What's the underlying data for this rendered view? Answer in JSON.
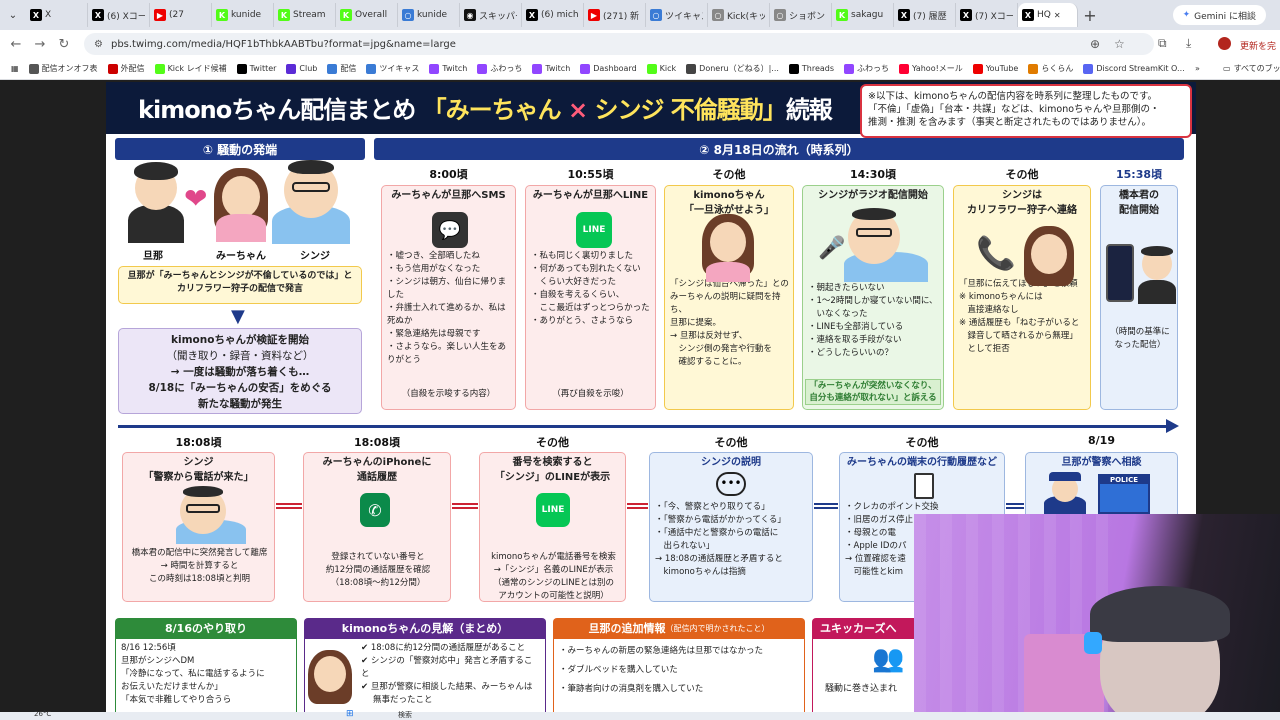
{
  "tabs": [
    {
      "label": "X",
      "color": "#000",
      "glyph": "X"
    },
    {
      "label": "(6) Xコー",
      "color": "#000",
      "glyph": "X"
    },
    {
      "label": "(27",
      "color": "#e00",
      "glyph": "▶"
    },
    {
      "label": "kunide",
      "color": "#53fc18",
      "glyph": "K"
    },
    {
      "label": "Stream",
      "color": "#53fc18",
      "glyph": "K"
    },
    {
      "label": "Overall",
      "color": "#53fc18",
      "glyph": "K"
    },
    {
      "label": "kunide",
      "color": "#3a7bd5",
      "glyph": "○"
    },
    {
      "label": "スキッパー",
      "color": "#111",
      "glyph": "◉"
    },
    {
      "label": "(6) mich",
      "color": "#000",
      "glyph": "X"
    },
    {
      "label": "(271) 新",
      "color": "#e00",
      "glyph": "▶"
    },
    {
      "label": "ツイキャス",
      "color": "#3a7bd5",
      "glyph": "○"
    },
    {
      "label": "Kick(キッ",
      "color": "#888",
      "glyph": "○"
    },
    {
      "label": "ショボン",
      "color": "#888",
      "glyph": "○"
    },
    {
      "label": "sakagu",
      "color": "#53fc18",
      "glyph": "K"
    },
    {
      "label": "(7) 履歴",
      "color": "#000",
      "glyph": "X"
    },
    {
      "label": "(7) Xコー",
      "color": "#000",
      "glyph": "X"
    },
    {
      "label": "HQ",
      "color": "#000",
      "glyph": "X",
      "active": true
    }
  ],
  "gemini_label": "Gemini に相談",
  "url": "pbs.twimg.com/media/HQF1bThbkAABTbu?format=jpg&name=large",
  "update_label": "更新を完",
  "bookmarks": [
    {
      "label": "配信オンオフ表",
      "color": "#555"
    },
    {
      "label": "外配信",
      "color": "#c00"
    },
    {
      "label": "Kick レイド候補",
      "color": "#53fc18"
    },
    {
      "label": "Twitter",
      "color": "#000"
    },
    {
      "label": "Club",
      "color": "#5b2bd6"
    },
    {
      "label": "配信",
      "color": "#3a7bd5"
    },
    {
      "label": "ツイキャス",
      "color": "#3a7bd5"
    },
    {
      "label": "Twitch",
      "color": "#9146ff"
    },
    {
      "label": "ふわっち",
      "color": "#9146ff"
    },
    {
      "label": "Twitch",
      "color": "#9146ff"
    },
    {
      "label": "Dashboard",
      "color": "#9146ff"
    },
    {
      "label": "Kick",
      "color": "#53fc18"
    },
    {
      "label": "Doneru（どねる）|...",
      "color": "#444"
    },
    {
      "label": "Threads",
      "color": "#000"
    },
    {
      "label": "ふわっち",
      "color": "#9146ff"
    },
    {
      "label": "Yahoo!メール",
      "color": "#f03"
    },
    {
      "label": "YouTube",
      "color": "#e00"
    },
    {
      "label": "らくらん",
      "color": "#e07b00"
    },
    {
      "label": "Discord StreamKit O...",
      "color": "#5865f2"
    }
  ],
  "all_bookmarks": "すべてのブッ",
  "infographic": {
    "title_a": "kimonoちゃん配信まとめ",
    "title_b": "「みーちゃん",
    "title_x": "×",
    "title_c": "シンジ 不倫騒動」",
    "title_d": "続報",
    "notice_1": "※以下は、kimonoちゃんの配信内容を時系列に整理したものです。",
    "notice_2": "「不倫」「虚偽」「台本・共謀」などは、kimonoちゃんや旦那側の・",
    "notice_3": "推測・推測 を含みます（事実と断定されたものではありません）。",
    "sec1": "① 騒動の発端",
    "sec2": "② 8月18日の流れ（時系列）",
    "people": [
      "旦那",
      "みーちゃん",
      "シンジ"
    ],
    "origin_note": "旦那が「みーちゃんとシンジが不倫しているのでは」とカリフラワー狩子の配信で発言",
    "origin_box": [
      "kimonoちゃんが検証を開始",
      "（聞き取り・録音・資料など）",
      "→ 一度は騒動が落ち着くも…",
      "8/18に「みーちゃんの安否」をめぐる",
      "新たな騒動が発生"
    ],
    "top_cols": [
      {
        "time": "8:00頃",
        "head": "みーちゃんが旦那へSMS",
        "lines": [
          "・嘘つき、全部晒したね",
          "・もう信用がなくなった",
          "・シンジは朝方、仙台に帰りました",
          "・弁護士入れて進めるか、私は死ぬか",
          "・緊急連絡先は母親です",
          "・さようなら。楽しい人生をありがとう"
        ],
        "foot": "（自殺を示唆する内容）"
      },
      {
        "time": "10:55頃",
        "head": "みーちゃんが旦那へLINE",
        "lines": [
          "・私も同じく裏切りました",
          "・何があっても別れたくない",
          "　くらい大好きだった",
          "・自殺を考えるくらい、",
          "　ここ最近はずっとつらかった",
          "・ありがとう、さようなら"
        ],
        "foot": "（再び自殺を示唆）"
      },
      {
        "time": "その他",
        "head": "kimonoちゃん",
        "head2": "「一旦泳がせよう」",
        "lines": [
          "「シンジは仙台へ帰った」との",
          "みーちゃんの説明に疑問を持ち、",
          "旦那に提案。",
          "→ 旦那は反対せず、",
          "　シンジ側の発言や行動を",
          "　確認することに。"
        ]
      },
      {
        "time": "14:30頃",
        "head": "シンジがラジオ配信開始",
        "lines": [
          "・朝起きたらいない",
          "・1〜2時間しか寝ていない間に、",
          "　いなくなった",
          "・LINEも全部消している",
          "・連絡を取る手段がない",
          "・どうしたらいいの？"
        ],
        "foot": "「みーちゃんが突然いなくなり、自分も連絡が取れない」と訴える"
      },
      {
        "time": "その他",
        "head": "シンジは",
        "head2": "カリフラワー狩子へ連絡",
        "lines": [
          "「旦那に伝えてほしい」と依頼",
          "※ kimonoちゃんには",
          "　直接連絡なし",
          "※ 通話履歴も「ねむ子がいると",
          "　録音して晒されるから無理」",
          "　として拒否"
        ]
      },
      {
        "time": "15:38頃",
        "head": "橋本君の",
        "head2": "配信開始",
        "lines": [
          "（時間の基準に",
          "なった配信）"
        ]
      }
    ],
    "bottom_cols": [
      {
        "time": "18:08頃",
        "head": "シンジ",
        "head2": "「警察から電話が来た」",
        "lines": [
          "橋本君の配信中に突然発言して離席",
          "→ 時間を計算すると",
          "この時刻は18:08頃と判明"
        ]
      },
      {
        "time": "18:08頃",
        "head": "みーちゃんのiPhoneに",
        "head2": "通話履歴",
        "lines": [
          "登録されていない番号と",
          "約12分間の通話履歴を確認",
          "（18:08頃〜約12分間）"
        ]
      },
      {
        "time": "その他",
        "head": "番号を検索すると",
        "head2": "「シンジ」のLINEが表示",
        "lines": [
          "kimonoちゃんが電話番号を検索",
          "→「シンジ」名義のLINEが表示",
          "（通常のシンジのLINEとは別の",
          "アカウントの可能性と説明）"
        ]
      },
      {
        "time": "その他",
        "head": "シンジの説明",
        "lines": [
          "・「今、警察とやり取りてる」",
          "・「警察から電話がかかってくる」",
          "・「通話中だと警察からの電話に",
          "　出られない」",
          "→ 18:08の通話履歴と矛盾すると",
          "　kimonoちゃんは指摘"
        ]
      },
      {
        "time": "その他",
        "head": "みーちゃんの端末の行動履歴など",
        "lines": [
          "・クレカのポイント交換",
          "・旧居のガス停止",
          "・母親との電",
          "・Apple IDのパ",
          "→ 位置確認を遠",
          "　可能性とkim"
        ]
      },
      {
        "time": "8/19",
        "head": "旦那が警察へ相談",
        "police": "POLICE"
      }
    ],
    "b1_head": "8/16のやり取り",
    "b1_lines": [
      "8/16 12:56頃",
      "旦那がシンジへDM",
      "「冷静になって、私に電話するように",
      "お伝えいただけませんか」",
      "「本気で非難してやり合うら"
    ],
    "b2_head": "kimonoちゃんの見解（まとめ）",
    "b2_lines": [
      "18:08に約12分間の通話履歴があること",
      "シンジの「警察対応中」発言と矛盾すること",
      "旦那が警察に相談した結果、みーちゃんは",
      "無事だったこと"
    ],
    "b3_head": "旦那の追加情報",
    "b3_sub": "（配信内で明かされたこと）",
    "b3_lines": [
      "・みーちゃんの新居の緊急連絡先は旦那ではなかった",
      "・ダブルベッドを購入していた",
      "・筆跡者向けの消臭剤を購入していた"
    ],
    "b4_head": "ユキッカーズへ",
    "b4_line": "騒動に巻き込まれ"
  },
  "taskbar": {
    "weather": "26°C",
    "search": "検索"
  }
}
